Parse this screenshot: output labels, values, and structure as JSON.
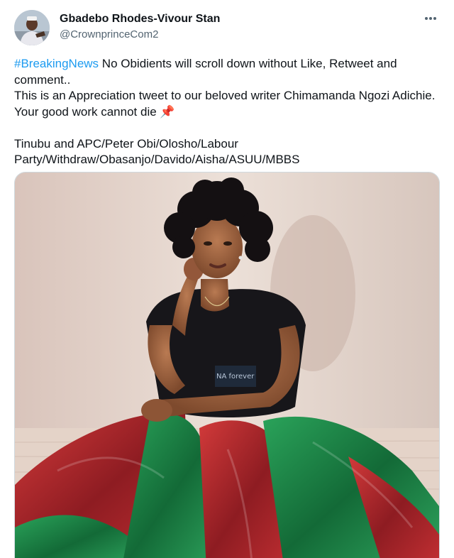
{
  "author": {
    "display_name": "Gbadebo Rhodes-Vivour Stan",
    "handle": "@CrownprinceCom2"
  },
  "more_icon": "more-horizontal-icon",
  "tweet": {
    "hashtag": "#BreakingNews",
    "line1_rest": " No Obidients will scroll down without Like, Retweet and comment..",
    "line2": "This is an Appreciation tweet to our beloved writer Chimamanda Ngozi Adichie. Your good work cannot die ",
    "pin_emoji": "📌",
    "tags_line": "Tinubu and APC/Peter Obi/Olosho/Labour Party/Withdraw/Obasanjo/Davido/Aisha/ASUU/MBBS"
  },
  "media": {
    "shirt_text": "NA forever"
  },
  "colors": {
    "link": "#1d9bf0",
    "text": "#0f1419",
    "secondary": "#536471",
    "skirt_red": "#b8262c",
    "skirt_green": "#1f8a4a"
  }
}
